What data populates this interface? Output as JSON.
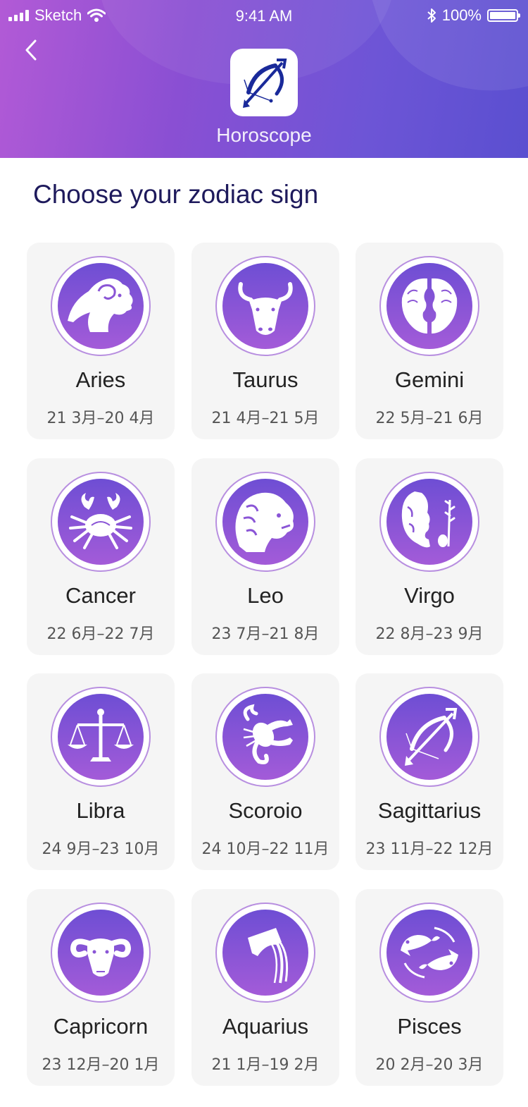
{
  "status_bar": {
    "carrier": "Sketch",
    "time": "9:41 AM",
    "battery": "100%"
  },
  "header": {
    "app_name": "Horoscope",
    "icon": "sagittarius-icon"
  },
  "page_title": "Choose your zodiac sign",
  "signs": [
    {
      "name": "Aries",
      "dates": "21 3月–20 4月",
      "icon": "aries-icon"
    },
    {
      "name": "Taurus",
      "dates": "21 4月–21 5月",
      "icon": "taurus-icon"
    },
    {
      "name": "Gemini",
      "dates": "22 5月–21 6月",
      "icon": "gemini-icon"
    },
    {
      "name": "Cancer",
      "dates": "22 6月–22 7月",
      "icon": "cancer-icon"
    },
    {
      "name": "Leo",
      "dates": "23 7月–21 8月",
      "icon": "leo-icon"
    },
    {
      "name": "Virgo",
      "dates": "22 8月–23 9月",
      "icon": "virgo-icon"
    },
    {
      "name": "Libra",
      "dates": "24 9月–23 10月",
      "icon": "libra-icon"
    },
    {
      "name": "Scoroio",
      "dates": "24 10月–22 11月",
      "icon": "scorpio-icon"
    },
    {
      "name": "Sagittarius",
      "dates": "23 11月–22 12月",
      "icon": "sagittarius-icon"
    },
    {
      "name": "Capricorn",
      "dates": "23 12月–20 1月",
      "icon": "capricorn-icon"
    },
    {
      "name": "Aquarius",
      "dates": "21 1月–19 2月",
      "icon": "aquarius-icon"
    },
    {
      "name": "Pisces",
      "dates": "20 2月–20 3月",
      "icon": "pisces-icon"
    }
  ],
  "colors": {
    "header_start": "#b25ad6",
    "header_end": "#5a4fd0",
    "title": "#1e1a5c",
    "medal_top": "#6e4ed4",
    "medal_bottom": "#a35bd8",
    "card_bg": "#f5f5f5"
  }
}
